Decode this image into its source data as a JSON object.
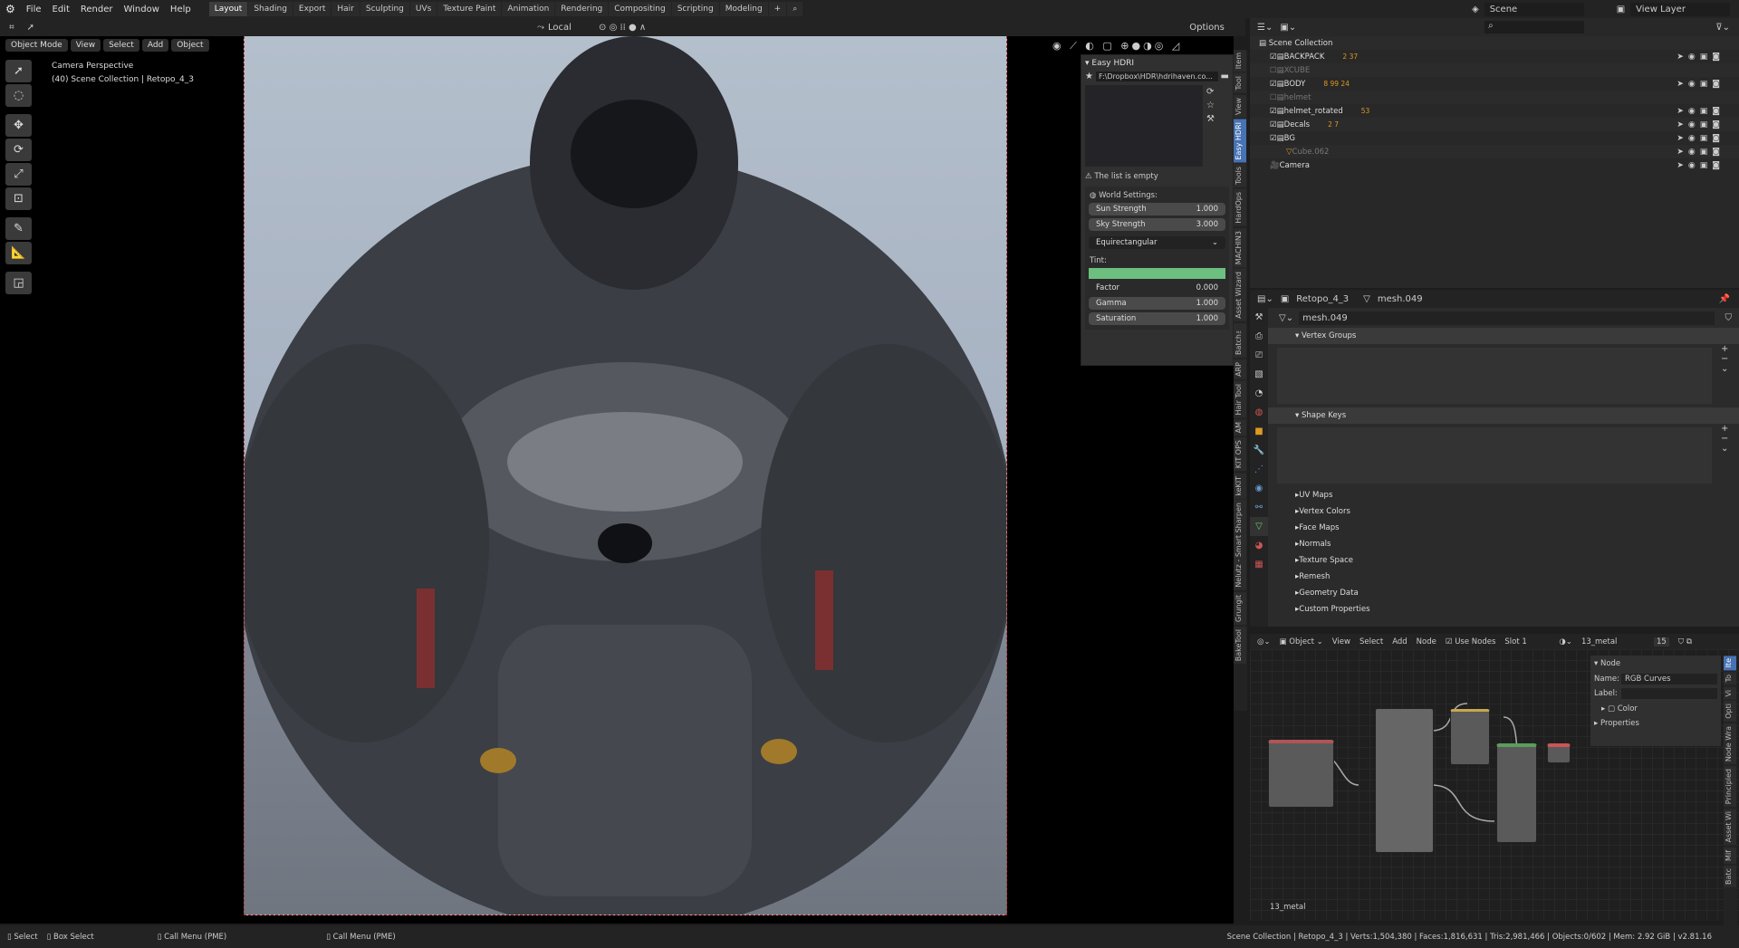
{
  "topbar": {
    "menus": [
      "File",
      "Edit",
      "Render",
      "Window",
      "Help"
    ],
    "workspaces": [
      "Layout",
      "Shading",
      "Export",
      "Hair",
      "Sculpting",
      "UVs",
      "Texture Paint",
      "Animation",
      "Rendering",
      "Compositing",
      "Scripting",
      "Modeling"
    ],
    "active_workspace": "Layout",
    "scene": "Scene",
    "view_layer": "View Layer"
  },
  "toolbar": {
    "orientation": "Local",
    "options": "Options"
  },
  "viewport": {
    "mode": "Object Mode",
    "menus": [
      "View",
      "Select",
      "Add",
      "Object"
    ],
    "overlay_title": "Camera Perspective",
    "overlay_sub": "(40) Scene Collection | Retopo_4_3"
  },
  "easy_hdri": {
    "title": "Easy HDRI",
    "path": "F:\\Dropbox\\HDR\\hdrihaven.co...",
    "empty_msg": "The list is empty",
    "world_settings": "World Settings:",
    "sun_label": "Sun Strength",
    "sun": "1.000",
    "sky_label": "Sky Strength",
    "sky": "3.000",
    "projection": "Equirectangular",
    "tint": "Tint:",
    "tint_color": "#6dbf80",
    "factor_label": "Factor",
    "factor": "0.000",
    "gamma_label": "Gamma",
    "gamma": "1.000",
    "sat_label": "Saturation",
    "saturation": "1.000"
  },
  "n_tabs": [
    "Item",
    "Tool",
    "View",
    "Easy HDRI",
    "Tools",
    "HardOps",
    "MACHIN3",
    "Asset Wizard",
    "Batch™",
    "ARP",
    "Hair Tool",
    "AM",
    "KIT OPS",
    "keKIT",
    "Nelutz - Smart Sharpen",
    "Grungit",
    "BakeTool"
  ],
  "outliner": {
    "root": "Scene Collection",
    "items": [
      {
        "name": "BACKPACK",
        "badges": "2 37",
        "dim": false
      },
      {
        "name": "XCUBE",
        "badges": "",
        "dim": true
      },
      {
        "name": "BODY",
        "badges": "8 99 24",
        "dim": false
      },
      {
        "name": "helmet",
        "badges": "",
        "dim": true
      },
      {
        "name": "helmet_rotated",
        "badges": "53",
        "dim": false
      },
      {
        "name": "Decals",
        "badges": "2 7",
        "dim": false
      },
      {
        "name": "BG",
        "badges": "",
        "dim": false
      },
      {
        "name": "Cube.062",
        "badges": "",
        "dim": true
      },
      {
        "name": "Camera",
        "badges": "",
        "dim": false
      }
    ]
  },
  "properties": {
    "object": "Retopo_4_3",
    "mesh": "mesh.049",
    "mesh_field": "mesh.049",
    "open_sections": [
      "Vertex Groups",
      "Shape Keys"
    ],
    "sections": [
      "UV Maps",
      "Vertex Colors",
      "Face Maps",
      "Normals",
      "Texture Space",
      "Remesh",
      "Geometry Data",
      "Custom Properties"
    ]
  },
  "node_editor": {
    "object": "Object",
    "menus": [
      "View",
      "Select",
      "Add",
      "Node"
    ],
    "use_nodes": "Use Nodes",
    "slot": "Slot 1",
    "material": "13_metal",
    "users": "15",
    "panel_title": "Node",
    "name_label": "Name:",
    "name": "RGB Curves",
    "label_label": "Label:",
    "color": "Color",
    "properties": "Properties",
    "footer": "13_metal",
    "tabs": [
      "Ite",
      "To",
      "Vi",
      "Opti",
      "Node Wra",
      "Principled",
      "Asset Wi",
      "Mif",
      "Batc"
    ]
  },
  "status": {
    "select": "Select",
    "box_select": "Box Select",
    "call_menu_1": "Call Menu (PME)",
    "call_menu_2": "Call Menu (PME)",
    "stats": "Scene Collection | Retopo_4_3 | Verts:1,504,380 | Faces:1,816,631 | Tris:2,981,466 | Objects:0/602 | Mem: 2.92 GiB | v2.81.16"
  }
}
